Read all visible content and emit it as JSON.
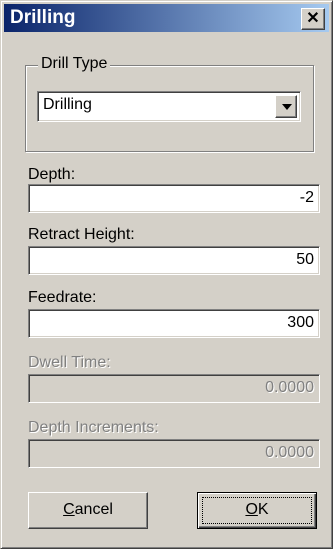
{
  "window": {
    "title": "Drilling",
    "close_glyph": "✕"
  },
  "drill_type": {
    "group_label": "Drill Type",
    "selected": "Drilling"
  },
  "fields": {
    "depth": {
      "label": "Depth:",
      "value": "-2"
    },
    "retract_height": {
      "label": "Retract Height:",
      "value": "50"
    },
    "feedrate": {
      "label": "Feedrate:",
      "value": "300"
    },
    "dwell_time": {
      "label": "Dwell Time:",
      "value": "0.0000"
    },
    "depth_increments": {
      "label": "Depth Increments:",
      "value": "0.0000"
    }
  },
  "buttons": {
    "cancel": {
      "mnemonic": "C",
      "rest": "ancel"
    },
    "ok": {
      "mnemonic": "O",
      "rest": "K"
    }
  },
  "colors": {
    "face": "#d4d0c8",
    "title_start": "#0a246a",
    "title_end": "#a6caf0",
    "disabled_text": "#808080"
  },
  "icons": {
    "close": "close-icon",
    "dropdown": "chevron-down-icon"
  }
}
